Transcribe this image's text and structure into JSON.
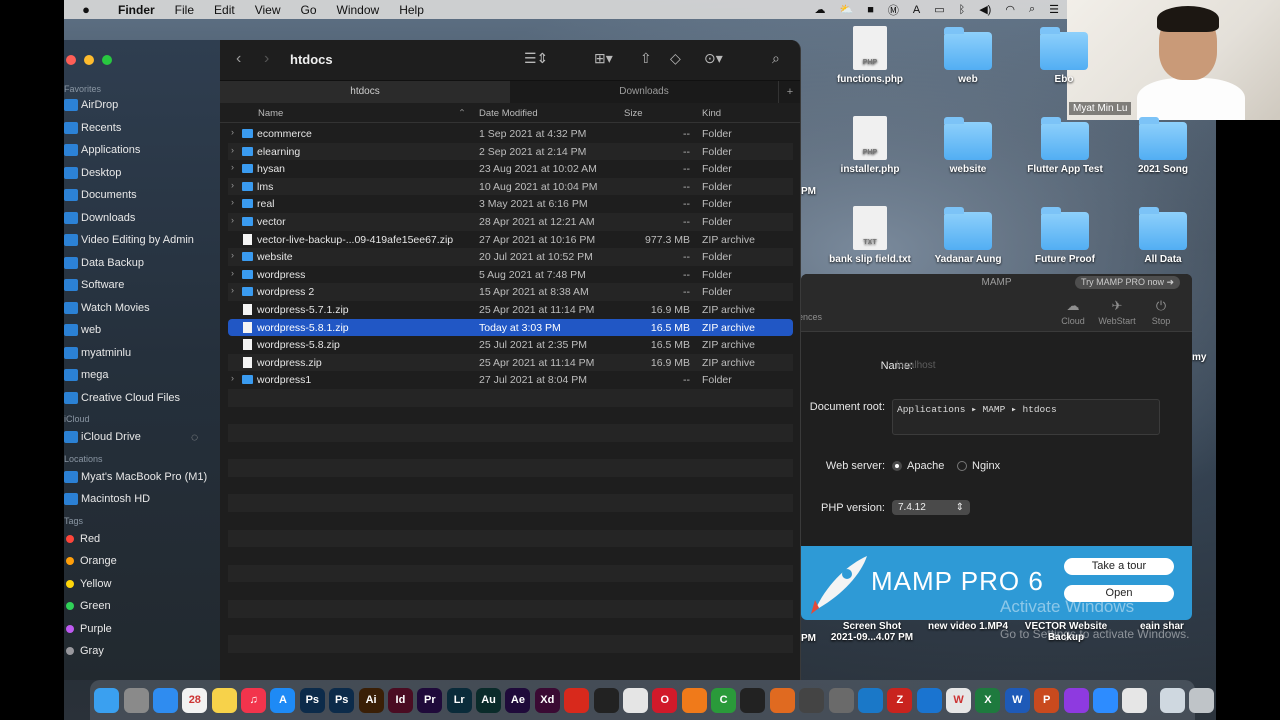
{
  "menubar": {
    "app_name": "Finder",
    "items": [
      "File",
      "Edit",
      "View",
      "Go",
      "Window",
      "Help"
    ]
  },
  "webcam": {
    "name": "Myat Min Lu"
  },
  "finder": {
    "title": "htdocs",
    "tabs": [
      {
        "label": "htdocs",
        "active": true
      },
      {
        "label": "Downloads",
        "active": false
      }
    ],
    "columns": {
      "name": "Name",
      "date": "Date Modified",
      "size": "Size",
      "kind": "Kind"
    },
    "sidebar": {
      "favorites_header": "Favorites",
      "favorites": [
        "AirDrop",
        "Recents",
        "Applications",
        "Desktop",
        "Documents",
        "Downloads",
        "Video Editing by Admin",
        "Data Backup",
        "Software",
        "Watch Movies",
        "web",
        "myatminlu",
        "mega",
        "Creative Cloud Files"
      ],
      "cloud_header": "iCloud",
      "cloud": [
        "iCloud Drive"
      ],
      "locations_header": "Locations",
      "locations": [
        "Myat's MacBook Pro (M1)",
        "Macintosh HD"
      ],
      "tags_header": "Tags",
      "tags": [
        {
          "label": "Red",
          "color": "#ff453a"
        },
        {
          "label": "Orange",
          "color": "#ff9f0a"
        },
        {
          "label": "Yellow",
          "color": "#ffd60a"
        },
        {
          "label": "Green",
          "color": "#30d158"
        },
        {
          "label": "Purple",
          "color": "#bf5af2"
        },
        {
          "label": "Gray",
          "color": "#98989d"
        }
      ]
    },
    "files": [
      {
        "name": "ecommerce",
        "date": "1 Sep 2021 at 4:32 PM",
        "size": "--",
        "kind": "Folder",
        "type": "folder"
      },
      {
        "name": "elearning",
        "date": "2 Sep 2021 at 2:14 PM",
        "size": "--",
        "kind": "Folder",
        "type": "folder"
      },
      {
        "name": "hysan",
        "date": "23 Aug 2021 at 10:02 AM",
        "size": "--",
        "kind": "Folder",
        "type": "folder"
      },
      {
        "name": "lms",
        "date": "10 Aug 2021 at 10:04 PM",
        "size": "--",
        "kind": "Folder",
        "type": "folder"
      },
      {
        "name": "real",
        "date": "3 May 2021 at 6:16 PM",
        "size": "--",
        "kind": "Folder",
        "type": "folder"
      },
      {
        "name": "vector",
        "date": "28 Apr 2021 at 12:21 AM",
        "size": "--",
        "kind": "Folder",
        "type": "folder"
      },
      {
        "name": "vector-live-backup-...09-419afe15ee67.zip",
        "date": "27 Apr 2021 at 10:16 PM",
        "size": "977.3 MB",
        "kind": "ZIP archive",
        "type": "file"
      },
      {
        "name": "website",
        "date": "20 Jul 2021 at 10:52 PM",
        "size": "--",
        "kind": "Folder",
        "type": "folder"
      },
      {
        "name": "wordpress",
        "date": "5 Aug 2021 at 7:48 PM",
        "size": "--",
        "kind": "Folder",
        "type": "folder"
      },
      {
        "name": "wordpress 2",
        "date": "15 Apr 2021 at 8:38 AM",
        "size": "--",
        "kind": "Folder",
        "type": "folder"
      },
      {
        "name": "wordpress-5.7.1.zip",
        "date": "25 Apr 2021 at 11:14 PM",
        "size": "16.9 MB",
        "kind": "ZIP archive",
        "type": "file"
      },
      {
        "name": "wordpress-5.8.1.zip",
        "date": "Today at 3:03 PM",
        "size": "16.5 MB",
        "kind": "ZIP archive",
        "type": "file",
        "selected": true
      },
      {
        "name": "wordpress-5.8.zip",
        "date": "25 Jul 2021 at 2:35 PM",
        "size": "16.5 MB",
        "kind": "ZIP archive",
        "type": "file"
      },
      {
        "name": "wordpress.zip",
        "date": "25 Apr 2021 at 11:14 PM",
        "size": "16.9 MB",
        "kind": "ZIP archive",
        "type": "file"
      },
      {
        "name": "wordpress1",
        "date": "27 Jul 2021 at 8:04 PM",
        "size": "--",
        "kind": "Folder",
        "type": "folder"
      }
    ]
  },
  "desktop": {
    "items": [
      {
        "label": "functions.php",
        "type": "doc",
        "ext": "PHP"
      },
      {
        "label": "web",
        "type": "folder"
      },
      {
        "label": "Ebo",
        "type": "folder"
      },
      {
        "label": "installer.php",
        "type": "doc",
        "ext": "PHP"
      },
      {
        "label": "website",
        "type": "folder"
      },
      {
        "label": "Flutter App Test",
        "type": "folder"
      },
      {
        "label": "2021 Song",
        "type": "folder"
      },
      {
        "label": "bank slip field.txt",
        "type": "doc",
        "ext": "TXT"
      },
      {
        "label": "Yadanar Aung",
        "type": "folder"
      },
      {
        "label": "Future Proof",
        "type": "folder"
      },
      {
        "label": "All Data",
        "type": "folder"
      }
    ],
    "bottom_labels": [
      {
        "line1": "Screen Shot",
        "line2": "2021-09...4.07 PM"
      },
      {
        "line1": "new video 1.MP4",
        "line2": ""
      },
      {
        "line1": "VECTOR Website",
        "line2": "Backup"
      },
      {
        "line1": "eain shar",
        "line2": ""
      }
    ],
    "left_edge_labels": [
      "PM",
      "PM"
    ],
    "right_edge_label": "my"
  },
  "mamp": {
    "title": "MAMP",
    "promo": "Try MAMP PRO now",
    "toolbar": {
      "left_partial": "ences",
      "cloud": "Cloud",
      "webstart": "WebStart",
      "stop": "Stop"
    },
    "name_label": "Name:",
    "name_placeholder": "localhost",
    "docroot_label": "Document root:",
    "docroot_value": "Applications ▸ MAMP ▸ htdocs",
    "webserver_label": "Web server:",
    "webserver_options": [
      "Apache",
      "Nginx"
    ],
    "webserver_selected": "Apache",
    "php_label": "PHP version:",
    "php_value": "7.4.12",
    "banner_title": "MAMP PRO 6",
    "btn_tour": "Take a tour",
    "btn_open": "Open"
  },
  "watermark": {
    "line1": "Activate Windows",
    "line2": "Go to Settings to activate Windows."
  },
  "dock": {
    "icons": [
      {
        "name": "finder",
        "glyph": "",
        "color": "#3aa0f0"
      },
      {
        "name": "launchpad",
        "glyph": "",
        "color": "#8a8a8a"
      },
      {
        "name": "safari",
        "glyph": "",
        "color": "#2f8cf0"
      },
      {
        "name": "calendar",
        "glyph": "28",
        "color": "#f2f2f2"
      },
      {
        "name": "notes",
        "glyph": "",
        "color": "#f7d24a"
      },
      {
        "name": "music",
        "glyph": "♫",
        "color": "#f2344c"
      },
      {
        "name": "app-store",
        "glyph": "A",
        "color": "#1e8af5"
      },
      {
        "name": "photoshop",
        "glyph": "Ps",
        "color": "#0c2b4a"
      },
      {
        "name": "photoshop-2",
        "glyph": "Ps",
        "color": "#0c2b4a"
      },
      {
        "name": "illustrator",
        "glyph": "Ai",
        "color": "#3a1f06"
      },
      {
        "name": "indesign",
        "glyph": "Id",
        "color": "#4a0c22"
      },
      {
        "name": "premiere",
        "glyph": "Pr",
        "color": "#1f0a3a"
      },
      {
        "name": "lightroom",
        "glyph": "Lr",
        "color": "#0a2b3a"
      },
      {
        "name": "audition",
        "glyph": "Au",
        "color": "#0a2b2a"
      },
      {
        "name": "after-effects",
        "glyph": "Ae",
        "color": "#1f0a3a"
      },
      {
        "name": "xd",
        "glyph": "Xd",
        "color": "#3a0a33"
      },
      {
        "name": "acrobat",
        "glyph": "",
        "color": "#d8291c"
      },
      {
        "name": "voice-memos",
        "glyph": "",
        "color": "#222"
      },
      {
        "name": "chrome",
        "glyph": "",
        "color": "#e5e5e5"
      },
      {
        "name": "opera",
        "glyph": "O",
        "color": "#d11a2a"
      },
      {
        "name": "firefox",
        "glyph": "",
        "color": "#f07a1a"
      },
      {
        "name": "camtasia",
        "glyph": "C",
        "color": "#2a9a3a"
      },
      {
        "name": "final-cut",
        "glyph": "",
        "color": "#222"
      },
      {
        "name": "rocket-typist",
        "glyph": "",
        "color": "#e06a20"
      },
      {
        "name": "app-1",
        "glyph": "",
        "color": "#444"
      },
      {
        "name": "system-prefs",
        "glyph": "",
        "color": "#6a6a6a"
      },
      {
        "name": "vscode",
        "glyph": "",
        "color": "#1a78c8"
      },
      {
        "name": "filezilla",
        "glyph": "Z",
        "color": "#c9231e"
      },
      {
        "name": "xcode",
        "glyph": "",
        "color": "#1a74d0"
      },
      {
        "name": "wordpress-app",
        "glyph": "W",
        "color": "#e6e6e6"
      },
      {
        "name": "excel",
        "glyph": "X",
        "color": "#1e7a3e"
      },
      {
        "name": "word",
        "glyph": "W",
        "color": "#1e5ab8"
      },
      {
        "name": "powerpoint",
        "glyph": "P",
        "color": "#c94a1e"
      },
      {
        "name": "podcasts",
        "glyph": "",
        "color": "#8e3ae0"
      },
      {
        "name": "zoom",
        "glyph": "",
        "color": "#2d8cff"
      },
      {
        "name": "mamp",
        "glyph": "",
        "color": "#e6e6e6"
      },
      {
        "name": "downloads-stack",
        "glyph": "",
        "color": "#cfd8e0"
      },
      {
        "name": "trash",
        "glyph": "",
        "color": "#bfc4c8"
      }
    ]
  }
}
